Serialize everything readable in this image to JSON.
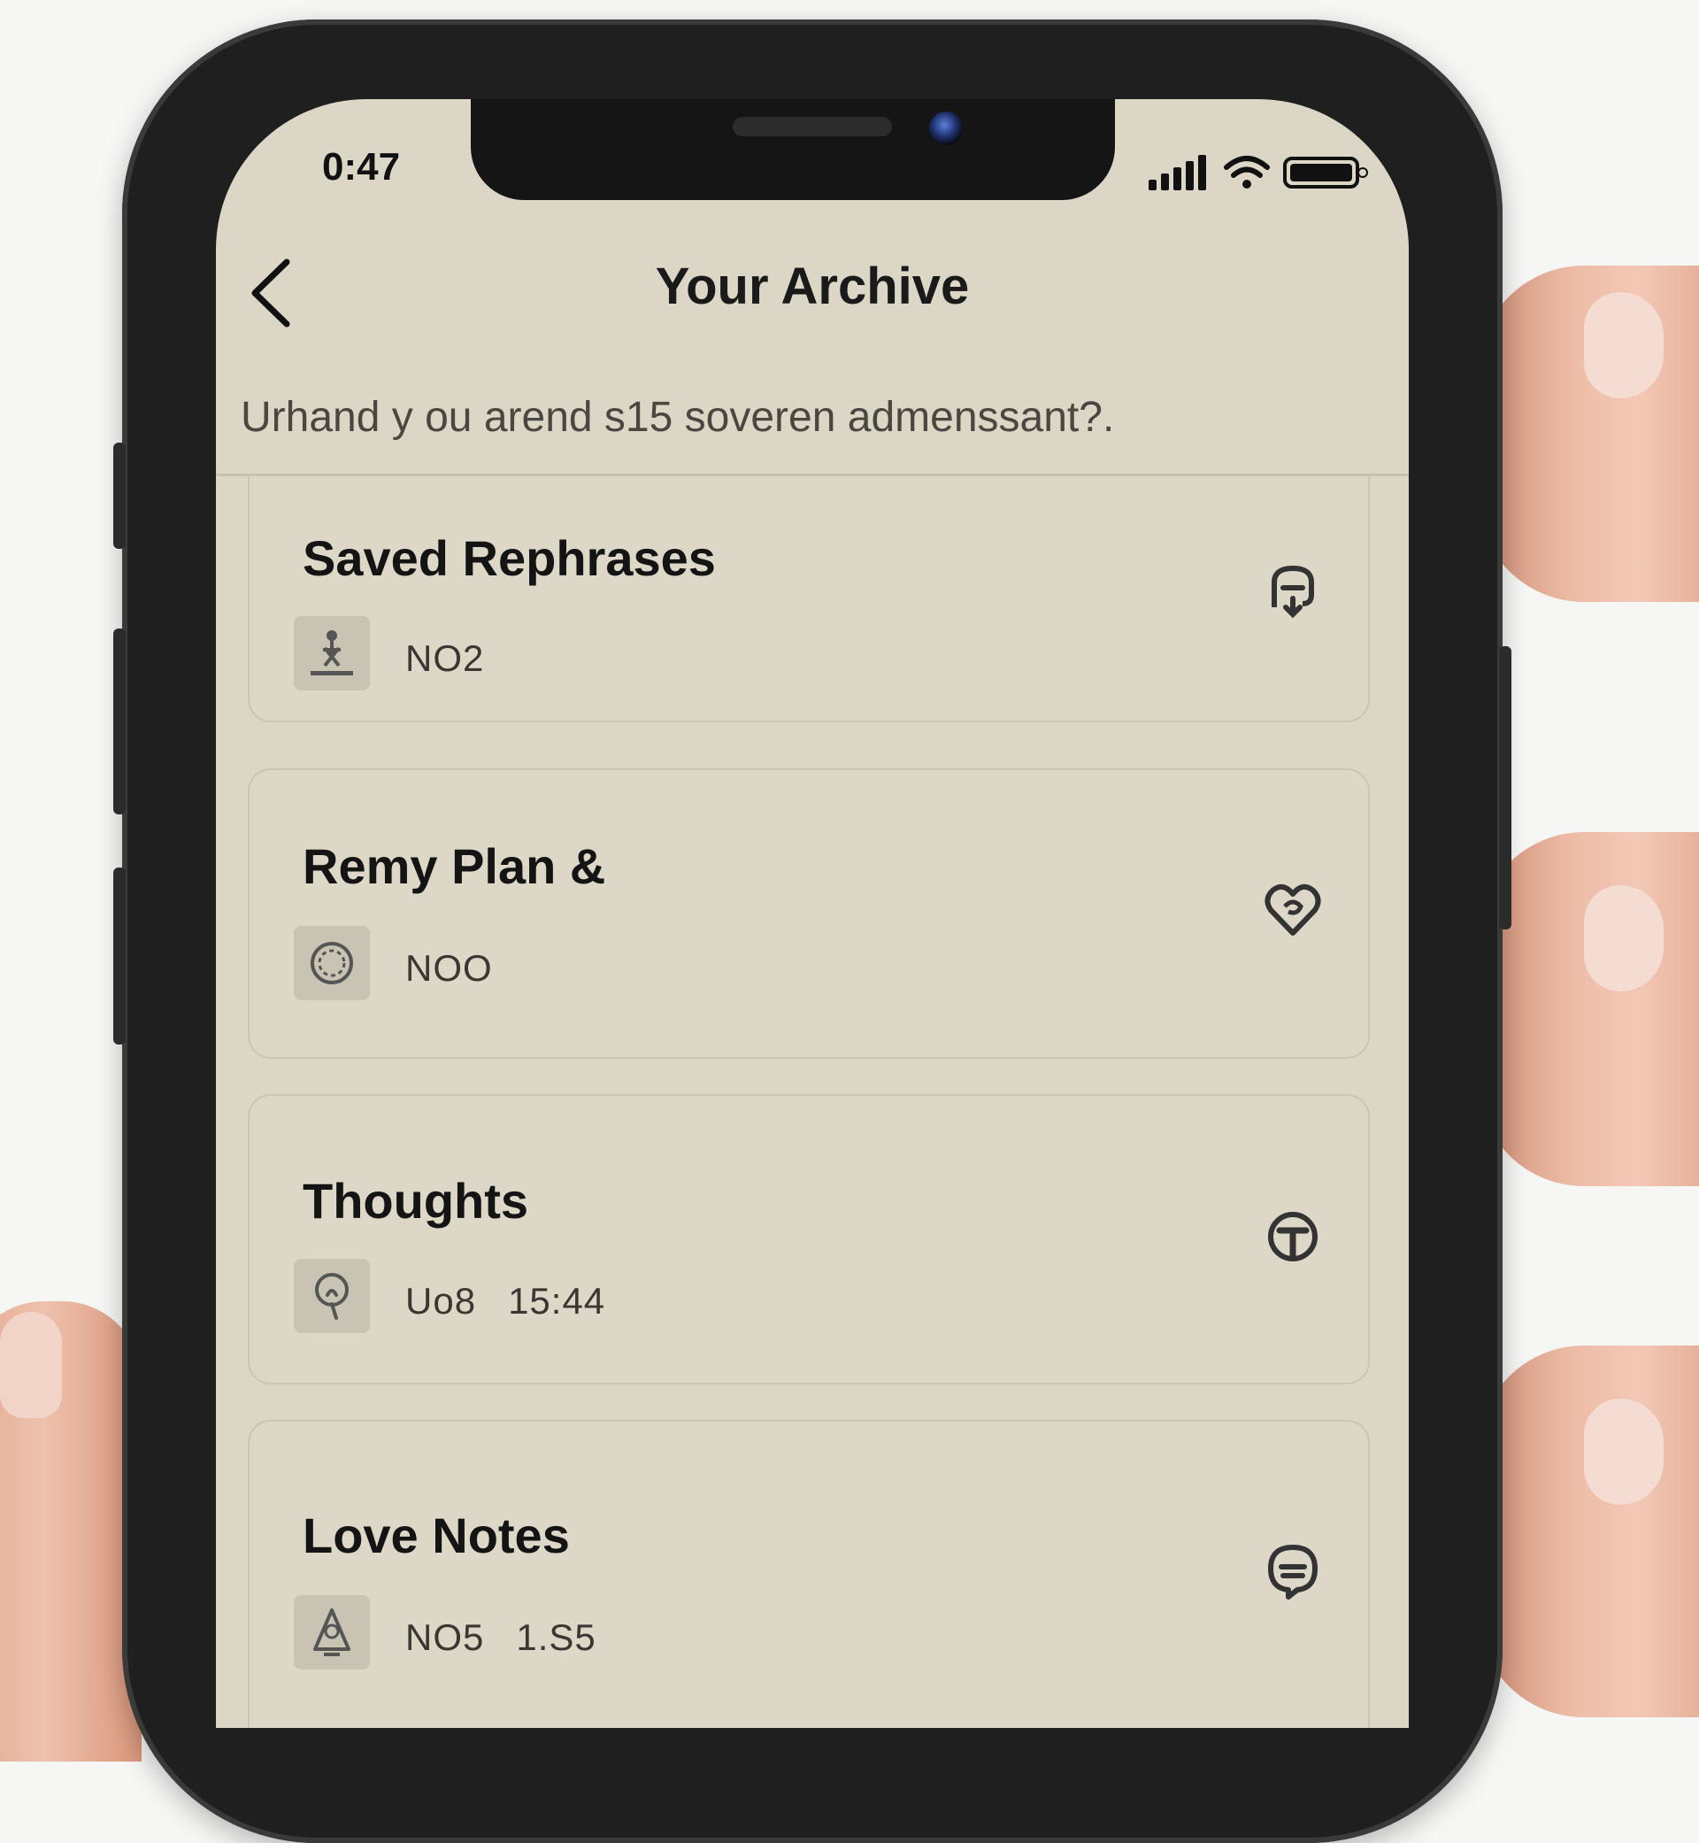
{
  "status_bar": {
    "time": "0:47"
  },
  "header": {
    "title": "Your Archive"
  },
  "subtitle": "Urhand y ou arend s15 soveren admenssant?.",
  "cards": [
    {
      "title": "Saved Rephrases",
      "meta": [
        "NO2"
      ],
      "thumb_icon": "figure-icon",
      "action_icon": "bookmark-arrow-icon"
    },
    {
      "title": "Remy Plan &",
      "meta": [
        "NOO"
      ],
      "thumb_icon": "wreath-icon",
      "action_icon": "heart-swirl-icon"
    },
    {
      "title": "Thoughts",
      "meta": [
        "Uo8",
        "15:44"
      ],
      "thumb_icon": "lightbulb-icon",
      "action_icon": "circle-t-icon"
    },
    {
      "title": "Love Notes",
      "meta": [
        "NO5",
        "1.S5"
      ],
      "thumb_icon": "figure-alt-icon",
      "action_icon": "chat-face-icon"
    }
  ],
  "colors": {
    "screen_bg": "#dbd6c6",
    "card_border": "#cbc5b6",
    "text": "#141414"
  }
}
